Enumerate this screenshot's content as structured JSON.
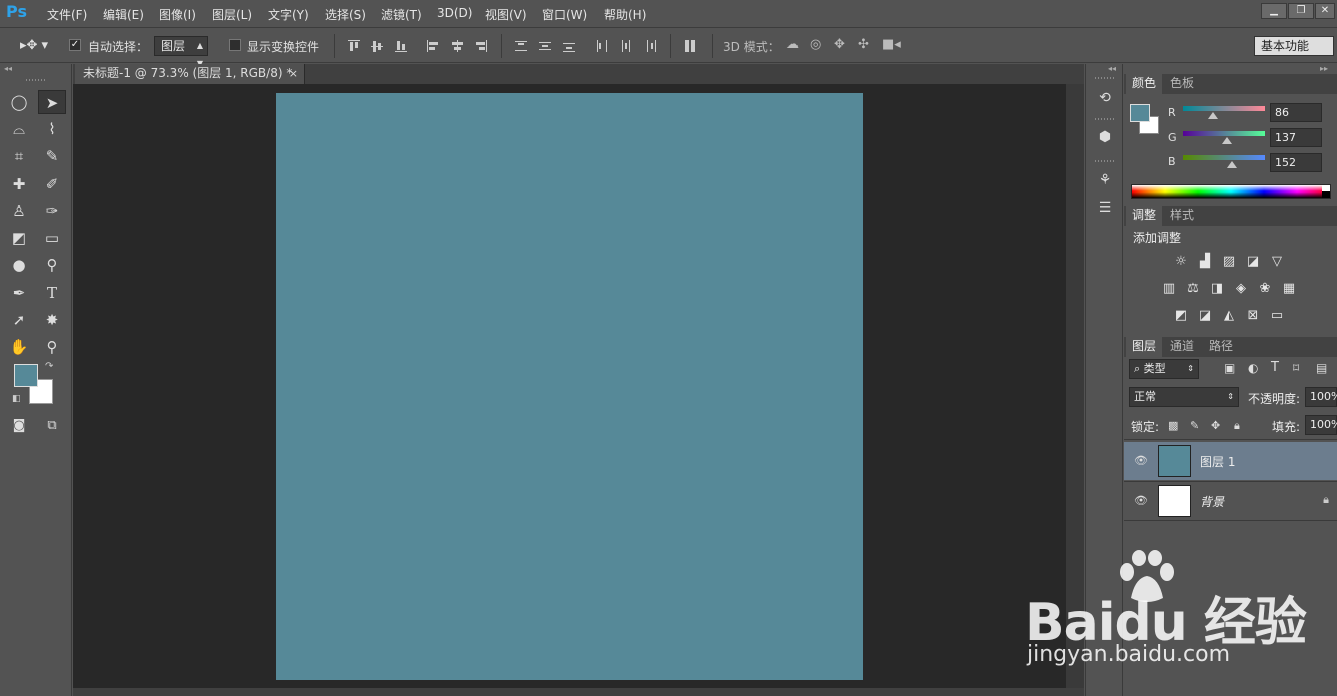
{
  "app": {
    "logo": "Ps"
  },
  "menu": [
    "文件(F)",
    "编辑(E)",
    "图像(I)",
    "图层(L)",
    "文字(Y)",
    "选择(S)",
    "滤镜(T)",
    "3D(D)",
    "视图(V)",
    "窗口(W)",
    "帮助(H)"
  ],
  "window_controls": [
    "minimize",
    "restore",
    "close"
  ],
  "options_bar": {
    "auto_select_label": "自动选择：",
    "auto_select_checked": true,
    "auto_select_target": "图层",
    "show_transform_label": "显示变换控件",
    "show_transform_checked": false,
    "mode_3d_label": "3D 模式：",
    "workspace": "基本功能"
  },
  "document": {
    "tab_title": "未标题-1 @ 73.3% (图层 1, RGB/8) *",
    "fill_color": "#568998"
  },
  "color_panel": {
    "tabs": [
      "颜色",
      "色板"
    ],
    "active_tab": "颜色",
    "foreground": "#568998",
    "background": "#ffffff",
    "channels": [
      {
        "label": "R",
        "value": "86"
      },
      {
        "label": "G",
        "value": "137"
      },
      {
        "label": "B",
        "value": "152"
      }
    ]
  },
  "adjustments_panel": {
    "tabs": [
      "调整",
      "样式"
    ],
    "active_tab": "调整",
    "heading": "添加调整",
    "icons": [
      [
        "brightness-icon",
        "levels-icon",
        "curves-icon",
        "exposure-icon",
        "vibrance-icon"
      ],
      [
        "hue-saturation-icon",
        "color-balance-icon",
        "black-white-icon",
        "photo-filter-icon",
        "channel-mixer-icon",
        "color-lookup-icon"
      ],
      [
        "invert-icon",
        "posterize-icon",
        "threshold-icon",
        "selective-color-icon",
        "gradient-map-icon"
      ]
    ]
  },
  "layers_panel": {
    "tabs": [
      "图层",
      "通道",
      "路径"
    ],
    "active_tab": "图层",
    "filter_kind": "类型",
    "blend_mode": "正常",
    "opacity_label": "不透明度:",
    "opacity_value": "100%",
    "lock_label": "锁定:",
    "fill_label": "填充:",
    "fill_value": "100%",
    "layers": [
      {
        "name": "图层 1",
        "thumb_color": "#568998",
        "selected": true,
        "locked": false
      },
      {
        "name": "背景",
        "thumb_color": "#ffffff",
        "selected": false,
        "locked": true
      }
    ]
  },
  "watermark": {
    "brand": "Baidu 经验",
    "url": "jingyan.baidu.com"
  }
}
